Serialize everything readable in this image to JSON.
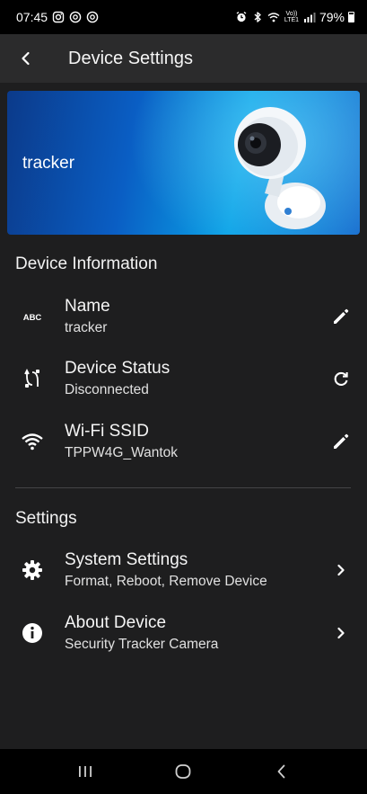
{
  "status_bar": {
    "time": "07:45",
    "network_label": "Vo)) LTE1",
    "battery": "79%"
  },
  "app_bar": {
    "back_icon": "chevron-left-icon",
    "title": "Device Settings"
  },
  "banner": {
    "device_name": "tracker"
  },
  "device_information": {
    "header": "Device Information",
    "items": [
      {
        "icon": "abc-icon",
        "title": "Name",
        "value": "tracker",
        "action_icon": "edit-icon"
      },
      {
        "icon": "device-status-icon",
        "title": "Device Status",
        "value": "Disconnected",
        "action_icon": "refresh-icon"
      },
      {
        "icon": "wifi-icon",
        "title": "Wi-Fi SSID",
        "value": "TPPW4G_Wantok",
        "action_icon": "edit-icon"
      }
    ]
  },
  "settings": {
    "header": "Settings",
    "items": [
      {
        "icon": "gear-icon",
        "title": "System Settings",
        "value": "Format, Reboot, Remove Device",
        "action_icon": "chevron-right-icon"
      },
      {
        "icon": "info-icon",
        "title": "About Device",
        "value": "Security Tracker Camera",
        "action_icon": "chevron-right-icon"
      }
    ]
  },
  "nav_bar": {
    "buttons": [
      "recent-apps-icon",
      "home-icon",
      "back-icon"
    ]
  },
  "colors": {
    "background": "#1e1e1f",
    "app_bar": "#2b2b2c",
    "banner_start": "#0b3a8a",
    "banner_end": "#0aa2e6",
    "text": "#f5f5f5"
  }
}
